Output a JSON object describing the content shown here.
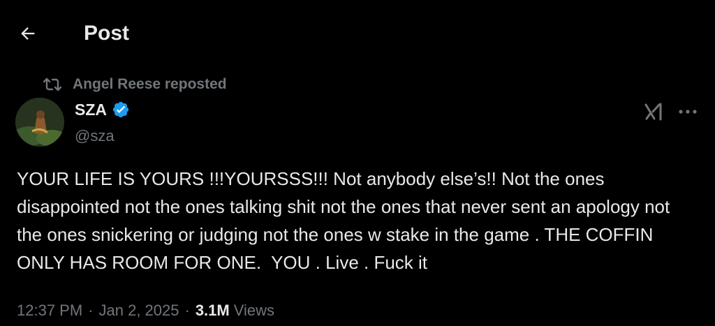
{
  "header": {
    "title": "Post"
  },
  "repost": {
    "text": "Angel Reese reposted"
  },
  "author": {
    "display_name": "SZA",
    "handle": "@sza",
    "verified": true
  },
  "tweet": {
    "text": "YOUR LIFE IS YOURS !!!YOURSSS!!! Not anybody else’s!! Not the ones disappointed not the ones talking shit not the ones that never sent an apology not the ones snickering or judging not the ones w stake in the game . THE COFFIN ONLY HAS ROOM FOR ONE.  YOU . Live . Fuck it"
  },
  "meta": {
    "time": "12:37 PM",
    "separator": "·",
    "date": "Jan 2, 2025",
    "views_count": "3.1M",
    "views_label": "Views"
  },
  "colors": {
    "background": "#000000",
    "text_primary": "#e7e9ea",
    "text_secondary": "#71767b",
    "verified_blue": "#1d9bf0"
  },
  "icons": {
    "back": "back-arrow-icon",
    "repost": "repost-icon",
    "verified": "verified-badge-icon",
    "grok": "grok-icon",
    "more": "more-icon"
  }
}
